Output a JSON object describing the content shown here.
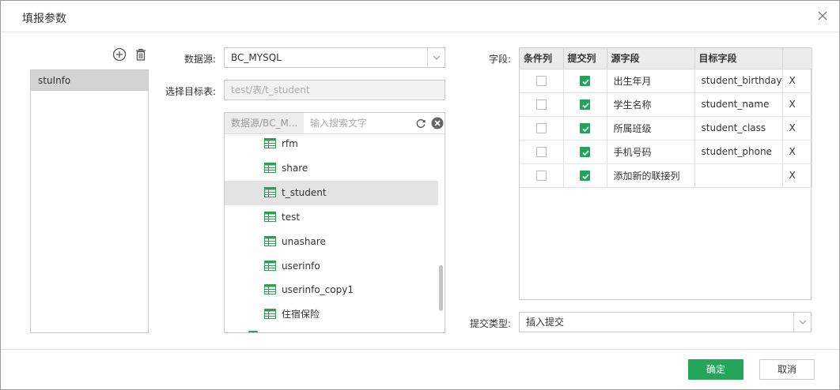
{
  "dialog": {
    "title": "填报参数"
  },
  "left": {
    "items": [
      {
        "label": "stuInfo",
        "selected": true
      }
    ]
  },
  "datasource": {
    "label": "数据源:",
    "value": "BC_MYSQL"
  },
  "target_table": {
    "label": "选择目标表:",
    "value": "test/表/t_student"
  },
  "tree": {
    "source": "数据源/BC_M...",
    "search_placeholder": "输入搜索文字",
    "items": [
      {
        "label": "rfm"
      },
      {
        "label": "share"
      },
      {
        "label": "t_student"
      },
      {
        "label": "test"
      },
      {
        "label": "unashare"
      },
      {
        "label": "userinfo"
      },
      {
        "label": "userinfo_copy1"
      },
      {
        "label": "住宿保险"
      }
    ],
    "selected_item": "t_student"
  },
  "fields": {
    "label": "字段:",
    "headers": [
      "条件列",
      "提交列",
      "源字段",
      "目标字段",
      ""
    ],
    "rows": [
      {
        "condition": false,
        "submit": true,
        "source": "出生年月",
        "target": "student_birthday",
        "remove": "X"
      },
      {
        "condition": false,
        "submit": true,
        "source": "学生名称",
        "target": "student_name",
        "remove": "X"
      },
      {
        "condition": false,
        "submit": true,
        "source": "所属班级",
        "target": "student_class",
        "remove": "X"
      },
      {
        "condition": false,
        "submit": true,
        "source": "手机号码",
        "target": "student_phone",
        "remove": "X"
      },
      {
        "condition": false,
        "submit": true,
        "source": "添加新的联接列",
        "target": "",
        "remove": "X"
      }
    ]
  },
  "submit_type": {
    "label": "提交类型:",
    "value": "插入提交"
  },
  "footer": {
    "ok": "确定",
    "cancel": "取消"
  },
  "colors": {
    "accent": "#26a65b",
    "selected_bg": "#d3d3d3"
  }
}
